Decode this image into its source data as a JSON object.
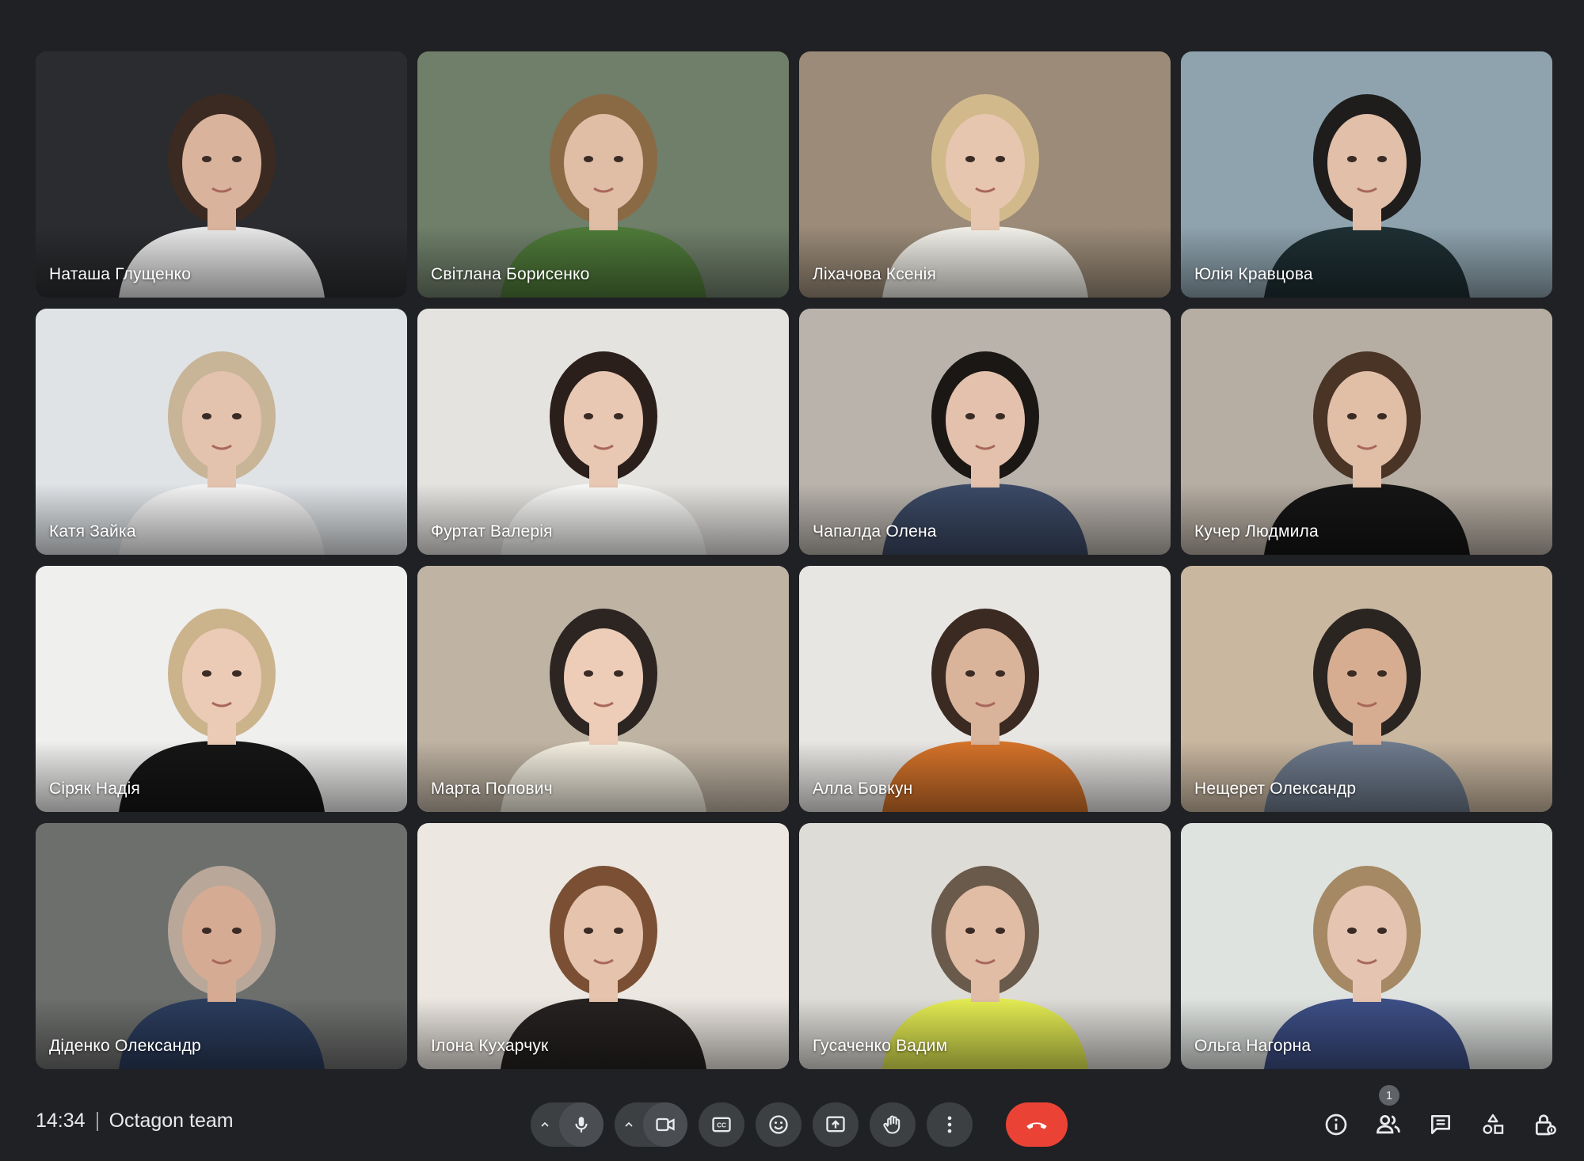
{
  "meeting": {
    "time": "14:34",
    "title": "Octagon team"
  },
  "participants": [
    {
      "name": "Наташа Глущенко",
      "bg": "#2b2c2f",
      "skin": "#d9b39c",
      "hair": "#3b2a22",
      "shirt": "#e8e8e8"
    },
    {
      "name": "Світлана Борисенко",
      "bg": "#6f7f6a",
      "skin": "#e0bda5",
      "hair": "#8a6a45",
      "shirt": "#4f7a3a"
    },
    {
      "name": "Ліхачова Ксенія",
      "bg": "#9b8b78",
      "skin": "#e6c6ae",
      "hair": "#d2b98c",
      "shirt": "#f1efe8"
    },
    {
      "name": "Юлія Кравцова",
      "bg": "#8ea3ae",
      "skin": "#e1bfa8",
      "hair": "#1f1c1c",
      "shirt": "#1e2f33"
    },
    {
      "name": "Катя Зайка",
      "bg": "#dfe3e6",
      "skin": "#e4c3ae",
      "hair": "#c8b497",
      "shirt": "#f4f4f4"
    },
    {
      "name": "Фуртат Валерія",
      "bg": "#e5e3e0",
      "skin": "#e8c7b3",
      "hair": "#2a1f1b",
      "shirt": "#f7f7f5"
    },
    {
      "name": "Чапалда Олена",
      "bg": "#b9b3ac",
      "skin": "#e3c1ad",
      "hair": "#1b1715",
      "shirt": "#3c4a66"
    },
    {
      "name": "Кучер Людмила",
      "bg": "#b7aea3",
      "skin": "#e1bea6",
      "hair": "#4a3426",
      "shirt": "#151515"
    },
    {
      "name": "Сіряк Надія",
      "bg": "#efefee",
      "skin": "#ebcab6",
      "hair": "#cbb38c",
      "shirt": "#161616"
    },
    {
      "name": "Марта Попович",
      "bg": "#bfb3a3",
      "skin": "#edcdb8",
      "hair": "#2c2522",
      "shirt": "#f3eee0"
    },
    {
      "name": "Алла Бовкун",
      "bg": "#e8e6e3",
      "skin": "#d9b39a",
      "hair": "#3a2a22",
      "shirt": "#d5732a"
    },
    {
      "name": "Нещерет Олександр",
      "bg": "#c9b7a0",
      "skin": "#d7ad92",
      "hair": "#2a2521",
      "shirt": "#6f7c8e"
    },
    {
      "name": "Діденко Олександр",
      "bg": "#6d6f6d",
      "skin": "#d6ab93",
      "hair": "#b9a89a",
      "shirt": "#2c3d5e"
    },
    {
      "name": "Ілона Кухарчук",
      "bg": "#ece7e1",
      "skin": "#e5c3ad",
      "hair": "#7a4f33",
      "shirt": "#262221"
    },
    {
      "name": "Гусаченко Вадим",
      "bg": "#dedcd7",
      "skin": "#e1bda5",
      "hair": "#6a5a4b",
      "shirt": "#e4ec52"
    },
    {
      "name": "Ольга Нагорна",
      "bg": "#dfe3e0",
      "skin": "#e5c5b1",
      "hair": "#a58964",
      "shirt": "#3d4f86"
    }
  ],
  "active_speaker_index": 9,
  "toolbar": {
    "participants_count": "1"
  },
  "icons": {
    "mic": "mic-icon",
    "camera": "videocam-icon",
    "captions": "closed-captions-icon",
    "emoji": "emoji-icon",
    "present": "present-screen-icon",
    "raise_hand": "raise-hand-icon",
    "more": "more-options-icon",
    "end": "end-call-icon",
    "info": "info-icon",
    "people": "people-icon",
    "chat": "chat-icon",
    "activities": "activities-icon",
    "host_controls": "host-controls-icon"
  },
  "colors": {
    "background": "#202124",
    "end_call": "#ea4335",
    "button": "#3c4043",
    "speaking_border": "#8ab4f8"
  }
}
